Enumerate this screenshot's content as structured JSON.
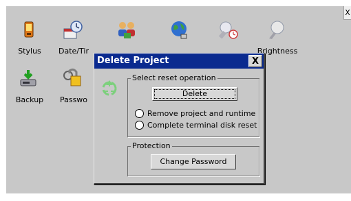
{
  "window": {
    "close_glyph": "X"
  },
  "desktop_icons": [
    {
      "label": "Stylus",
      "icon": "stylus-icon"
    },
    {
      "label": "Date/Tir",
      "icon": "date-time-icon"
    },
    {
      "label": "",
      "icon": "users-icon"
    },
    {
      "label": "",
      "icon": "network-globe-icon"
    },
    {
      "label": "",
      "icon": "screensaver-icon"
    },
    {
      "label": "Brightness",
      "icon": "brightness-icon"
    },
    {
      "label": "Backup",
      "icon": "backup-icon"
    },
    {
      "label": "Passwo",
      "icon": "password-lock-icon"
    }
  ],
  "dialog": {
    "title": "Delete Project",
    "close_glyph": "X",
    "reset_group": {
      "legend": "Select reset operation",
      "delete_button": "Delete",
      "options": [
        "Remove project and runtime",
        "Complete terminal disk reset"
      ]
    },
    "protection_group": {
      "legend": "Protection",
      "change_password_button": "Change Password"
    }
  },
  "colors": {
    "title_bar": "#0a2a8f",
    "desktop": "#c8c8c8"
  }
}
